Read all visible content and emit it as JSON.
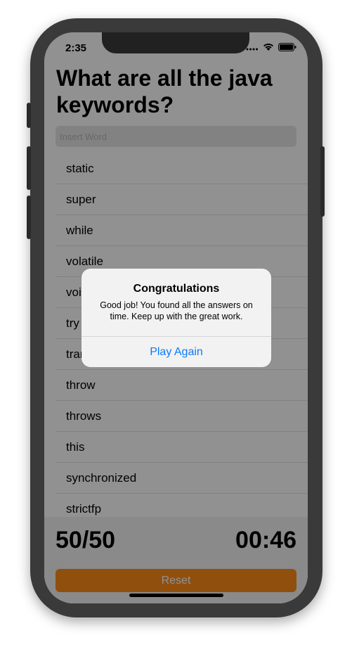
{
  "status": {
    "time": "2:35"
  },
  "quiz": {
    "title": "What are all the java keywords?",
    "input_placeholder": "Insert Word",
    "found_words": [
      "static",
      "super",
      "while",
      "volatile",
      "void",
      "try",
      "transient",
      "throw",
      "throws",
      "this",
      "synchronized",
      "strictfp"
    ]
  },
  "footer": {
    "score": "50/50",
    "timer": "00:46",
    "reset_label": "Reset"
  },
  "alert": {
    "title": "Congratulations",
    "message": "Good job! You found all the answers on time. Keep up with the great work.",
    "action_label": "Play Again"
  },
  "colors": {
    "accent": "#ff8c1a",
    "link": "#0a7aff"
  }
}
